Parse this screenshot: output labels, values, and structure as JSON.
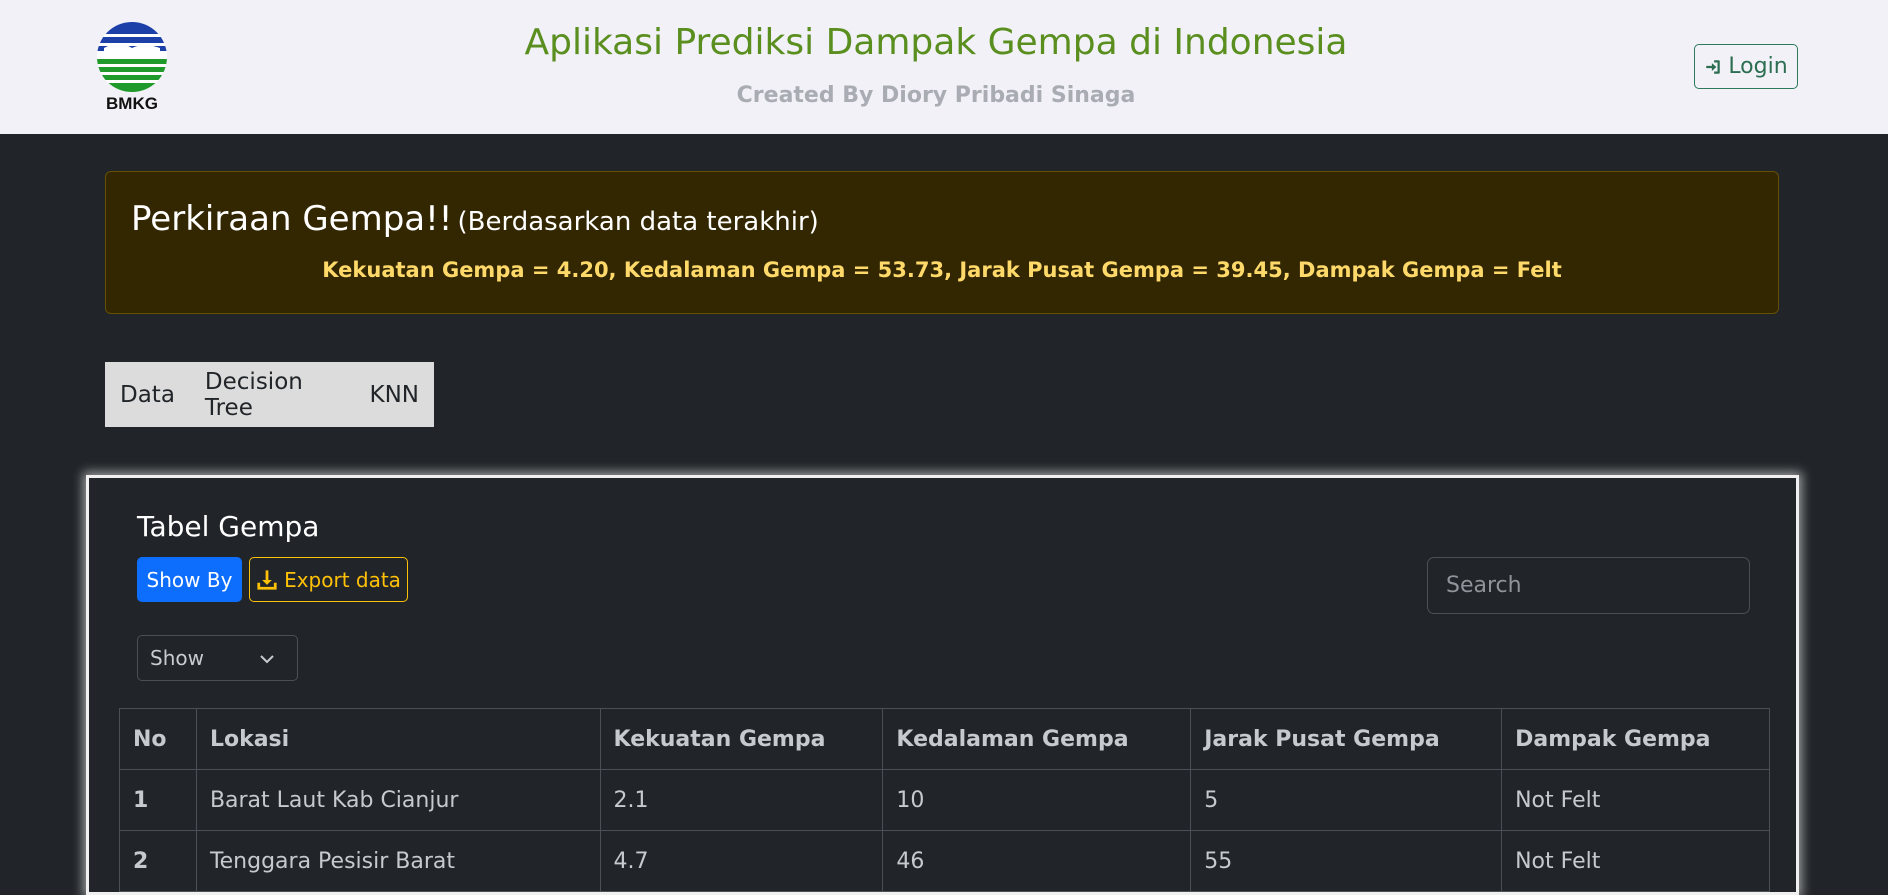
{
  "header": {
    "logo_text": "BMKG",
    "title": "Aplikasi Prediksi Dampak Gempa di Indonesia",
    "subtitle": "Created By Diory Pribadi Sinaga",
    "login_label": "Login"
  },
  "alert": {
    "heading": "Perkiraan Gempa!!",
    "heading_note": "(Berdasarkan data terakhir)",
    "body": "Kekuatan Gempa = 4.20, Kedalaman Gempa = 53.73, Jarak Pusat Gempa = 39.45, Dampak Gempa = Felt"
  },
  "tabs": [
    {
      "label": "Data"
    },
    {
      "label": "Decision Tree"
    },
    {
      "label": "KNN"
    }
  ],
  "card": {
    "title": "Tabel Gempa",
    "show_by_label": "Show By",
    "export_label": "Export data",
    "search_placeholder": "Search",
    "select_value": "Show"
  },
  "table": {
    "headers": [
      "No",
      "Lokasi",
      "Kekuatan Gempa",
      "Kedalaman Gempa",
      "Jarak Pusat Gempa",
      "Dampak Gempa"
    ],
    "rows": [
      [
        "1",
        "Barat Laut Kab Cianjur",
        "2.1",
        "10",
        "5",
        "Not Felt"
      ],
      [
        "2",
        "Tenggara Pesisir Barat",
        "4.7",
        "46",
        "55",
        "Not Felt"
      ]
    ]
  },
  "colors": {
    "title_green": "#5a8f1f",
    "alert_text": "#ffda6a",
    "primary": "#0d6efd",
    "warning": "#ffc107"
  }
}
